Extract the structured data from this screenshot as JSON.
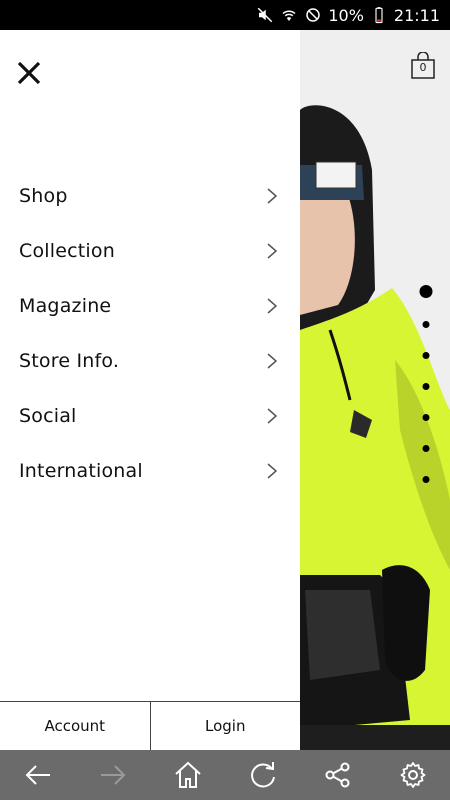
{
  "status_bar": {
    "battery": "10%",
    "time": "21:11",
    "icons": [
      "mute-icon",
      "wifi-icon",
      "do-not-disturb-icon",
      "battery-icon"
    ]
  },
  "hero": {
    "cart_count": "0",
    "cart_icon": "shopping-bag-icon",
    "slide_dots": 6,
    "active_slide": 1
  },
  "drawer": {
    "close_icon": "close-icon",
    "menu": [
      {
        "label": "Shop"
      },
      {
        "label": "Collection"
      },
      {
        "label": "Magazine"
      },
      {
        "label": "Store Info."
      },
      {
        "label": "Social"
      },
      {
        "label": "International"
      }
    ],
    "footer": {
      "account_label": "Account",
      "login_label": "Login"
    }
  },
  "toolbar": {
    "buttons": [
      "back-icon",
      "forward-icon",
      "home-icon",
      "refresh-icon",
      "share-icon",
      "settings-icon"
    ],
    "forward_enabled": false
  },
  "colors": {
    "drawer_bg": "#ffffff",
    "toolbar_bg": "#6b6b6b",
    "hoodie": "#d8f534",
    "accent_text": "#111111"
  }
}
